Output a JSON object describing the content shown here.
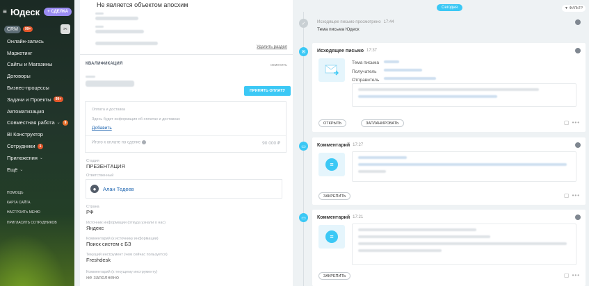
{
  "sidebar": {
    "logo": "Юдеск",
    "deal_button": "+ СДЕЛКА",
    "crm_label": "CRM",
    "crm_badge": "99+",
    "items": [
      {
        "label": "Онлайн-запись"
      },
      {
        "label": "Маркетинг"
      },
      {
        "label": "Сайты и Магазины"
      },
      {
        "label": "Договоры"
      },
      {
        "label": "Бизнес-процессы"
      },
      {
        "label": "Задачи и Проекты",
        "badge": "99+"
      },
      {
        "label": "Автоматизация"
      },
      {
        "label": "Совместная работа",
        "badge": "9",
        "chevron": true
      },
      {
        "label": "BI Конструктор"
      },
      {
        "label": "Сотрудники",
        "badge": "1"
      },
      {
        "label": "Приложения",
        "chevron": true
      },
      {
        "label": "Ещё",
        "chevron": true
      }
    ],
    "small_links": [
      "Помощь",
      "Карта сайта",
      "Настроить меню",
      "Пригласить сотрудников"
    ]
  },
  "left": {
    "top_title": "Не является объектом апосхим",
    "delete_section": "Удалить раздел",
    "kv_head": "КВАЛИФИКАЦИЯ",
    "kv_change": "изменить",
    "pay_button": "ПРИНЯТЬ ОПЛАТУ",
    "payment_label": "Оплата и доставка",
    "payment_hint": "Здесь будет информация об оплатах и доставках",
    "add_link": "Добавить",
    "total_label": "Итого к оплате по сделке",
    "total_value": "90 000 ₽",
    "fields": [
      {
        "label": "Стадия",
        "value": "ПРЕЗЕНТАЦИЯ"
      },
      {
        "label": "Ответственный",
        "value": "Алан Тедеев"
      },
      {
        "label": "Страна",
        "value": "РФ"
      },
      {
        "label": "Источник информации (откуда узнали о нас)",
        "value": "Яндекс"
      },
      {
        "label": "Комментарий (к источнику информации)",
        "value": "Поиск систем с БЗ"
      },
      {
        "label": "Текущий инструмент (чем сейчас пользуется)",
        "value": "Freshdesk"
      },
      {
        "label": "Комментарий (к текущему инструменту)",
        "value": "не заполнено"
      }
    ]
  },
  "timeline": {
    "today": "Сегодня",
    "filter": "ФИЛЬТР",
    "viewed": {
      "title": "Исходящее письмо просмотрено",
      "time": "17:44",
      "subject": "Тема письма Юдеск"
    },
    "email": {
      "title": "Исходящее письмо",
      "time": "17:37",
      "rows": [
        "Тема письма",
        "Получатель",
        "Отправитель"
      ],
      "btn_open": "ОТКРЫТЬ",
      "btn_plan": "ЗАПЛАНИРОВАТЬ"
    },
    "comment1": {
      "title": "Комментарий",
      "time": "17:27",
      "btn": "ЗАКРЕПИТЬ"
    },
    "comment2": {
      "title": "Комментарий",
      "time": "17:21",
      "btn": "ЗАКРЕПИТЬ"
    },
    "colors": {
      "accent": "#3bc8f5",
      "link": "#2066b0",
      "badge": "#e3572b"
    }
  }
}
